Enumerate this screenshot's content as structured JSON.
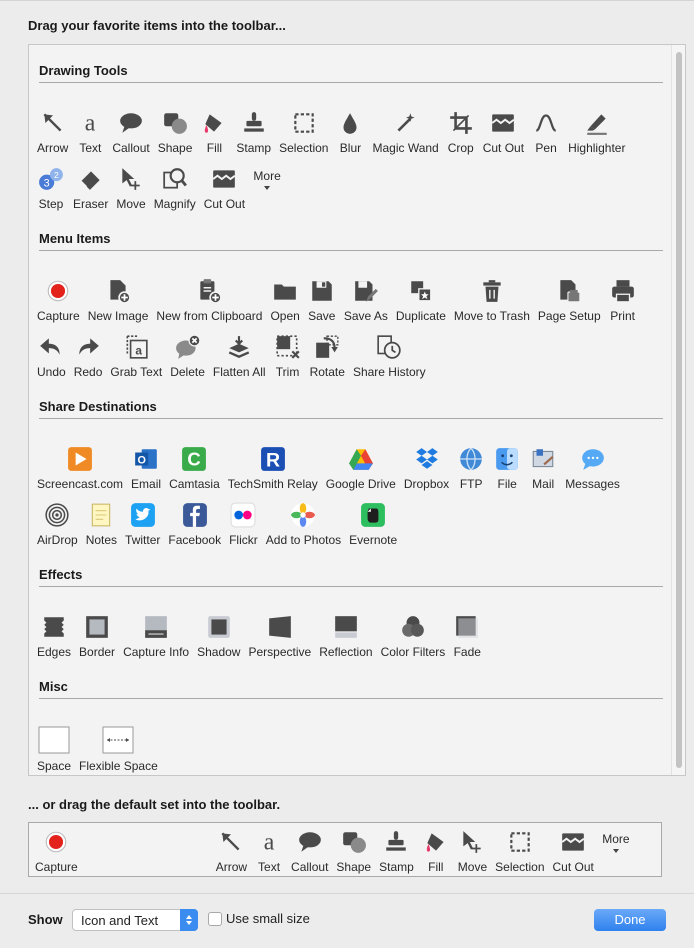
{
  "header": {
    "title": "Drag your favorite items into the toolbar...",
    "default_title": "... or drag the default set into the toolbar."
  },
  "sections": [
    {
      "title": "Drawing Tools",
      "rows": [
        [
          {
            "label": "Arrow",
            "icon": "arrow-icon"
          },
          {
            "label": "Text",
            "icon": "text-icon"
          },
          {
            "label": "Callout",
            "icon": "callout-icon"
          },
          {
            "label": "Shape",
            "icon": "shape-icon"
          },
          {
            "label": "Fill",
            "icon": "fill-icon"
          },
          {
            "label": "Stamp",
            "icon": "stamp-icon"
          },
          {
            "label": "Selection",
            "icon": "selection-icon"
          },
          {
            "label": "Blur",
            "icon": "blur-icon"
          },
          {
            "label": "Magic Wand",
            "icon": "magic-wand-icon"
          },
          {
            "label": "Crop",
            "icon": "crop-icon"
          },
          {
            "label": "Cut Out",
            "icon": "cut-out-icon"
          },
          {
            "label": "Pen",
            "icon": "pen-icon"
          },
          {
            "label": "Highlighter",
            "icon": "highlighter-icon"
          }
        ],
        [
          {
            "label": "Step",
            "icon": "step-icon"
          },
          {
            "label": "Eraser",
            "icon": "eraser-icon"
          },
          {
            "label": "Move",
            "icon": "move-icon"
          },
          {
            "label": "Magnify",
            "icon": "magnify-icon"
          },
          {
            "label": "Cut Out",
            "icon": "cut-out-icon"
          },
          {
            "label": "More",
            "icon": "more-icon"
          }
        ]
      ]
    },
    {
      "title": "Menu Items",
      "rows": [
        [
          {
            "label": "Capture",
            "icon": "record-icon"
          },
          {
            "label": "New Image",
            "icon": "new-image-icon"
          },
          {
            "label": "New from Clipboard",
            "icon": "clipboard-icon"
          },
          {
            "label": "Open",
            "icon": "folder-icon"
          },
          {
            "label": "Save",
            "icon": "save-icon"
          },
          {
            "label": "Save As",
            "icon": "save-as-icon"
          },
          {
            "label": "Duplicate",
            "icon": "duplicate-icon"
          },
          {
            "label": "Move to Trash",
            "icon": "trash-icon"
          },
          {
            "label": "Page Setup",
            "icon": "page-setup-icon"
          },
          {
            "label": "Print",
            "icon": "printer-icon"
          }
        ],
        [
          {
            "label": "Undo",
            "icon": "undo-icon"
          },
          {
            "label": "Redo",
            "icon": "redo-icon"
          },
          {
            "label": "Grab Text",
            "icon": "grab-text-icon"
          },
          {
            "label": "Delete",
            "icon": "delete-icon"
          },
          {
            "label": "Flatten All",
            "icon": "flatten-icon"
          },
          {
            "label": "Trim",
            "icon": "trim-icon"
          },
          {
            "label": "Rotate",
            "icon": "rotate-icon"
          },
          {
            "label": "Share History",
            "icon": "share-history-icon"
          }
        ]
      ]
    },
    {
      "title": "Share Destinations",
      "rows": [
        [
          {
            "label": "Screencast.com",
            "icon": "screencast-icon"
          },
          {
            "label": "Email",
            "icon": "outlook-icon"
          },
          {
            "label": "Camtasia",
            "icon": "camtasia-icon"
          },
          {
            "label": "TechSmith Relay",
            "icon": "relay-icon"
          },
          {
            "label": "Google Drive",
            "icon": "google-drive-icon"
          },
          {
            "label": "Dropbox",
            "icon": "dropbox-icon"
          },
          {
            "label": "FTP",
            "icon": "ftp-icon"
          },
          {
            "label": "File",
            "icon": "finder-icon"
          },
          {
            "label": "Mail",
            "icon": "mail-icon"
          },
          {
            "label": "Messages",
            "icon": "messages-icon"
          }
        ],
        [
          {
            "label": "AirDrop",
            "icon": "airdrop-icon"
          },
          {
            "label": "Notes",
            "icon": "notes-icon"
          },
          {
            "label": "Twitter",
            "icon": "twitter-icon"
          },
          {
            "label": "Facebook",
            "icon": "facebook-icon"
          },
          {
            "label": "Flickr",
            "icon": "flickr-icon"
          },
          {
            "label": "Add to Photos",
            "icon": "photos-icon"
          },
          {
            "label": "Evernote",
            "icon": "evernote-icon"
          }
        ]
      ]
    },
    {
      "title": "Effects",
      "rows": [
        [
          {
            "label": "Edges",
            "icon": "edges-icon"
          },
          {
            "label": "Border",
            "icon": "border-icon"
          },
          {
            "label": "Capture Info",
            "icon": "capture-info-icon"
          },
          {
            "label": "Shadow",
            "icon": "shadow-icon"
          },
          {
            "label": "Perspective",
            "icon": "perspective-icon"
          },
          {
            "label": "Reflection",
            "icon": "reflection-icon"
          },
          {
            "label": "Color Filters",
            "icon": "color-filters-icon"
          },
          {
            "label": "Fade",
            "icon": "fade-icon"
          }
        ]
      ]
    },
    {
      "title": "Misc",
      "rows": [
        [
          {
            "label": "Space",
            "icon": "space-icon"
          },
          {
            "label": "Flexible Space",
            "icon": "flexible-space-icon"
          }
        ]
      ]
    }
  ],
  "default_set": [
    {
      "label": "Capture",
      "icon": "record-icon"
    },
    {
      "label": "Arrow",
      "icon": "arrow-icon"
    },
    {
      "label": "Text",
      "icon": "text-icon"
    },
    {
      "label": "Callout",
      "icon": "callout-icon"
    },
    {
      "label": "Shape",
      "icon": "shape-icon"
    },
    {
      "label": "Stamp",
      "icon": "stamp-icon"
    },
    {
      "label": "Fill",
      "icon": "fill-icon"
    },
    {
      "label": "Move",
      "icon": "move-icon"
    },
    {
      "label": "Selection",
      "icon": "selection-icon"
    },
    {
      "label": "Cut Out",
      "icon": "cut-out-icon"
    },
    {
      "label": "More",
      "icon": "more-icon"
    }
  ],
  "footer": {
    "show_label": "Show",
    "show_value": "Icon and Text",
    "small_size_label": "Use small size",
    "small_size_checked": false,
    "done_label": "Done"
  },
  "colors": {
    "accent": "#3b8cf0",
    "record": "#e3221c",
    "icon_gray": "#4a4a4a"
  }
}
